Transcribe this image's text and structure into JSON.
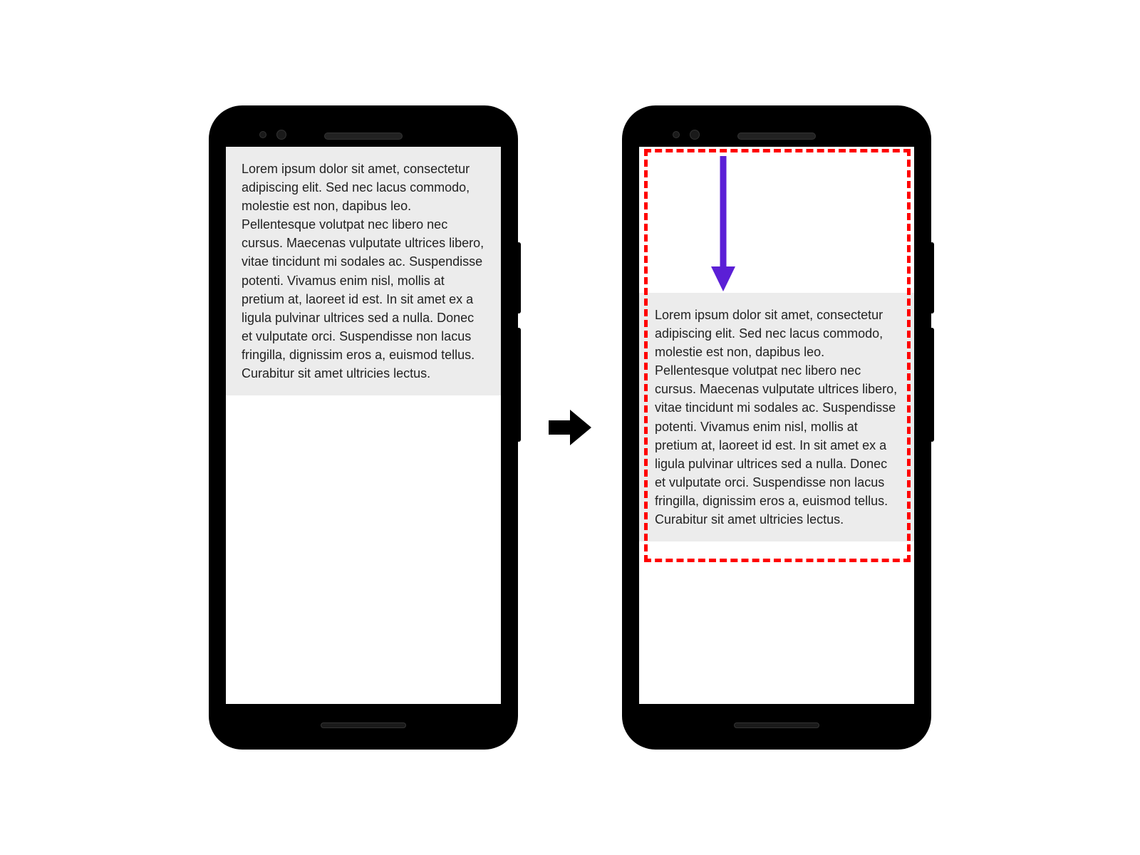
{
  "diagram": {
    "lorem_text": "Lorem ipsum dolor sit amet, consectetur adipiscing elit. Sed nec lacus commodo, molestie est non, dapibus leo. Pellentesque volutpat nec libero nec cursus. Maecenas vulputate ultrices libero, vitae tincidunt mi sodales ac. Suspendisse potenti. Vivamus enim nisl, mollis at pretium at, laoreet id est. In sit amet ex a ligula pulvinar ultrices sed a nulla. Donec et vulputate orci. Suspendisse non lacus fringilla, dignissim eros a, euismod tellus. Curabitur sit amet ultricies lectus.",
    "colors": {
      "highlight_border": "#ff0000",
      "arrow_down": "#5b1fd6",
      "arrow_between": "#000000",
      "text_background": "#ececec"
    }
  }
}
